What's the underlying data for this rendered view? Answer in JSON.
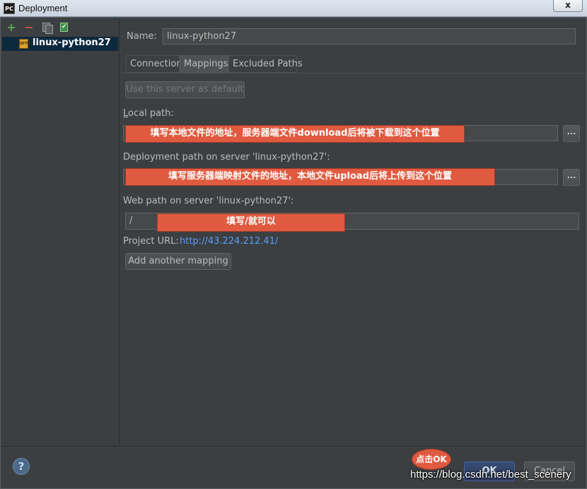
{
  "window": {
    "title": "Deployment",
    "app_icon_text": "PC",
    "close_label": "x"
  },
  "toolbar": {
    "icons": [
      "add-icon",
      "remove-icon",
      "copy-icon",
      "set-default-icon"
    ],
    "add_glyph": "+",
    "remove_glyph": "−"
  },
  "servers": [
    {
      "name": "linux-python27",
      "icon": "sftp-server-icon",
      "icon_text": "SFTP",
      "selected": true
    }
  ],
  "form": {
    "name_label": "Name:",
    "name_value": "linux-python27",
    "tabs": [
      {
        "label": "Connection",
        "active": false
      },
      {
        "label": "Mappings",
        "active": true
      },
      {
        "label": "Excluded Paths",
        "active": false
      }
    ],
    "use_default_label": "Use this server as default",
    "local_path_label": "Local path:",
    "local_path_value": "",
    "deployment_path_label": "Deployment path on server 'linux-python27':",
    "deployment_path_value": "",
    "web_path_label": "Web path on server 'linux-python27':",
    "web_path_value": "/",
    "project_url_label": "Project URL:",
    "project_url_value": "http://43.224.212.41/",
    "browse_label": "...",
    "add_mapping_label": "Add another mapping"
  },
  "annotations": {
    "local": "填写本地文件的地址，服务器端文件download后将被下载到这个位置",
    "deployment": "填写服务器端映射文件的地址，本地文件upload后将上传到这个位置",
    "web": "填写/就可以",
    "ok": "点击OK"
  },
  "footer": {
    "help_glyph": "?",
    "ok_label": "OK",
    "cancel_label": "Cancel"
  },
  "watermark": "https://blog.csdn.net/best_scenery",
  "colors": {
    "background": "#3c3f41",
    "selection": "#0d293e",
    "annotation": "#e05a40",
    "link": "#589df6"
  }
}
